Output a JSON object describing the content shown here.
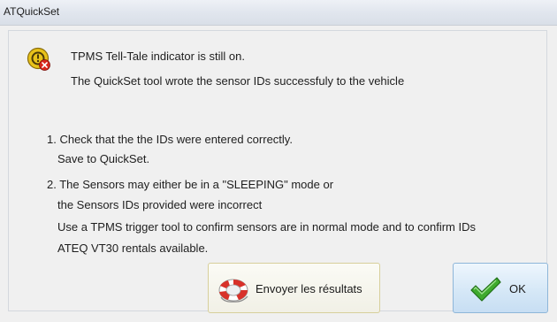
{
  "window": {
    "title": "ATQuickSet"
  },
  "message": {
    "line1": "TPMS Tell-Tale indicator is still on.",
    "line2": "The QuickSet tool wrote the sensor IDs successfuly to the vehicle"
  },
  "instructions": {
    "item1_line1": "1. Check that the the IDs were entered correctly.",
    "item1_line2": "Save to QuickSet.",
    "item2_line1": "2. The Sensors may either be in a \"SLEEPING\" mode or",
    "item2_line2": "the Sensors IDs provided were incorrect",
    "item2_line3": "Use a TPMS trigger tool to confirm sensors are in normal mode and to confirm IDs",
    "item2_line4": "ATEQ VT30 rentals available."
  },
  "buttons": {
    "send_label": "Envoyer les résultats",
    "ok_label": "OK"
  },
  "icons": {
    "status": "tpms-warning-icon",
    "send": "lifebuoy-icon",
    "ok": "green-checkmark-icon"
  },
  "colors": {
    "status_icon_yellow": "#e8c21a",
    "status_icon_red": "#d9261c",
    "lifebuoy_red": "#d8312a",
    "check_green": "#3faa2e"
  }
}
